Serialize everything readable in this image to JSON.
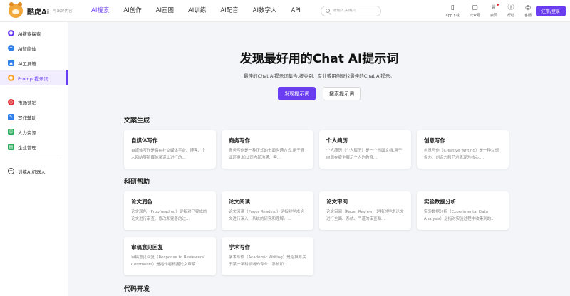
{
  "brand": {
    "name": "酷虎Ai",
    "tagline": "写出好内容"
  },
  "nav": {
    "items": [
      "AI搜索",
      "AI创作",
      "AI画图",
      "AI训练",
      "AI配音",
      "AI数字人",
      "API"
    ],
    "active": "AI搜索"
  },
  "search": {
    "placeholder": "请输入关键词"
  },
  "tools": [
    {
      "label": "app下载",
      "icon": "phone-icon"
    },
    {
      "label": "公众号",
      "icon": "wechat-icon"
    },
    {
      "label": "会员",
      "icon": "crown-icon"
    },
    {
      "label": "帮助",
      "icon": "help-icon"
    },
    {
      "label": "客服",
      "icon": "headset-icon"
    }
  ],
  "login_label": "注册/登录",
  "sidebar": {
    "group1": [
      {
        "label": "AI搜索探索",
        "icon": "compass-icon",
        "color": "#6b3df0"
      },
      {
        "label": "AI智能体",
        "icon": "agent-icon",
        "color": "#2f80ed"
      },
      {
        "label": "AI工具箱",
        "icon": "toolbox-icon",
        "color": "#2f80ed"
      },
      {
        "label": "Prompt提示词",
        "icon": "prompt-icon",
        "color": "#f5a623",
        "active": true
      }
    ],
    "group2": [
      {
        "label": "市场营销",
        "icon": "target-icon",
        "color": "#e0303a"
      },
      {
        "label": "写作辅助",
        "icon": "pen-icon",
        "color": "#2f80ed"
      },
      {
        "label": "人力资源",
        "icon": "people-icon",
        "color": "#27ae60"
      },
      {
        "label": "企业管理",
        "icon": "building-icon",
        "color": "#27ae60"
      }
    ],
    "train": {
      "label": "训练AI机器人",
      "icon": "plus-circle-icon"
    }
  },
  "hero": {
    "title": "发现最好用的Chat AI提示词",
    "subtitle": "最佳的Chat AI提示词集合,按类别、专业或用例查找最佳的Chat AI提示。",
    "primary_btn": "发现提示词",
    "secondary_btn": "搜索提示词"
  },
  "sections": [
    {
      "title": "文案生成",
      "cards": [
        {
          "title": "自媒体写作",
          "desc": "自媒体写作是指在社交媒体平台、博客、个人网站等新媒体渠道上进行的..."
        },
        {
          "title": "商务写作",
          "desc": "商务写作是一种正式的书面沟通方式,用于商业环境,如公司内部沟通、客..."
        },
        {
          "title": "个人简历",
          "desc": "个人简历（个人履历）是一个书面文档,用于向潜在雇主展示个人的教育..."
        },
        {
          "title": "创意写作",
          "desc": "创意写作（Creative Writing）是一种以想象力、创造力和艺术表现为核心,..."
        }
      ]
    },
    {
      "title": "科研帮助",
      "cards": [
        {
          "title": "论文润色",
          "desc": "论文润色（Proofreading）是指对已完成的论文进行审查、修改和完善的过..."
        },
        {
          "title": "论文阅读",
          "desc": "论文阅读（Paper Reading）是指对学术论文进行深入、系统的研究和理解。..."
        },
        {
          "title": "论文审阅",
          "desc": "论文审阅（Paper Review）是指对学术论文进行全面、系统、严谨的审查和..."
        },
        {
          "title": "实验数据分析",
          "desc": "实验数据分析（Experimental Data Analysis）是指对实验过程中收集到的..."
        },
        {
          "title": "审稿意见回复",
          "desc": "审稿意见回复（Response to Reviewers' Comments）是指作者根据论文审稿..."
        },
        {
          "title": "学术写作",
          "desc": "学术写作（Academic Writing）是指撰写关于某一学科领域的专业、系统和..."
        }
      ]
    },
    {
      "title": "代码开发",
      "cards": []
    }
  ]
}
